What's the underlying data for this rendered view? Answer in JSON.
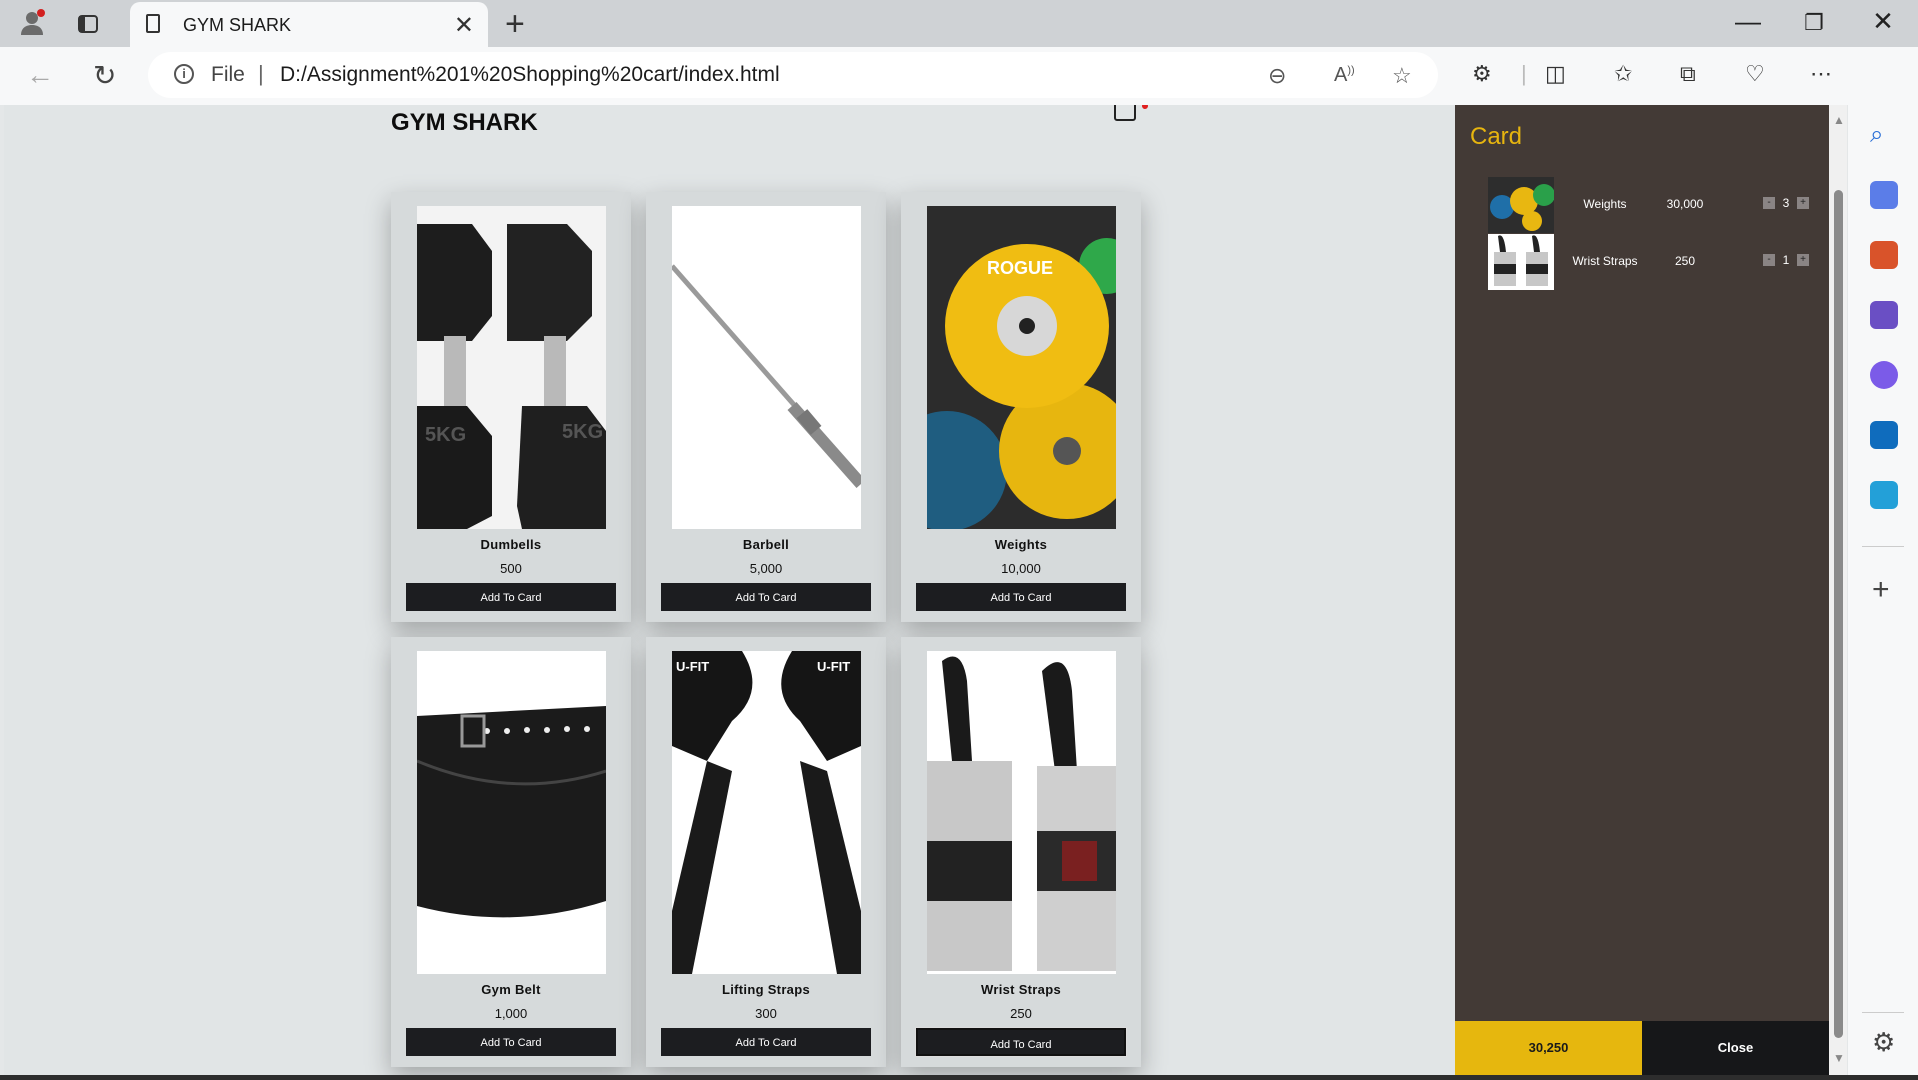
{
  "browser": {
    "tab_title": "GYM SHARK",
    "url_scheme": "File",
    "url": "D:/Assignment%201%20Shopping%20cart/index.html"
  },
  "page": {
    "brand": "GYM SHARK",
    "products": [
      {
        "name": "Dumbells",
        "price": "500",
        "button": "Add To Card"
      },
      {
        "name": "Barbell",
        "price": "5,000",
        "button": "Add To Card"
      },
      {
        "name": "Weights",
        "price": "10,000",
        "button": "Add To Card"
      },
      {
        "name": "Gym Belt",
        "price": "1,000",
        "button": "Add To Card"
      },
      {
        "name": "Lifting Straps",
        "price": "300",
        "button": "Add To Card"
      },
      {
        "name": "Wrist Straps",
        "price": "250",
        "button": "Add To Card"
      }
    ]
  },
  "cart": {
    "title": "Card",
    "items": [
      {
        "name": "Weights",
        "price": "30,000",
        "minus": "-",
        "qty": "3",
        "plus": "+"
      },
      {
        "name": "Wrist Straps",
        "price": "250",
        "minus": "-",
        "qty": "1",
        "plus": "+"
      }
    ],
    "total": "30,250",
    "close_label": "Close"
  },
  "colors": {
    "cart_bg": "#433a36",
    "accent": "#e6b70e",
    "button_bg": "#1c1d20"
  }
}
